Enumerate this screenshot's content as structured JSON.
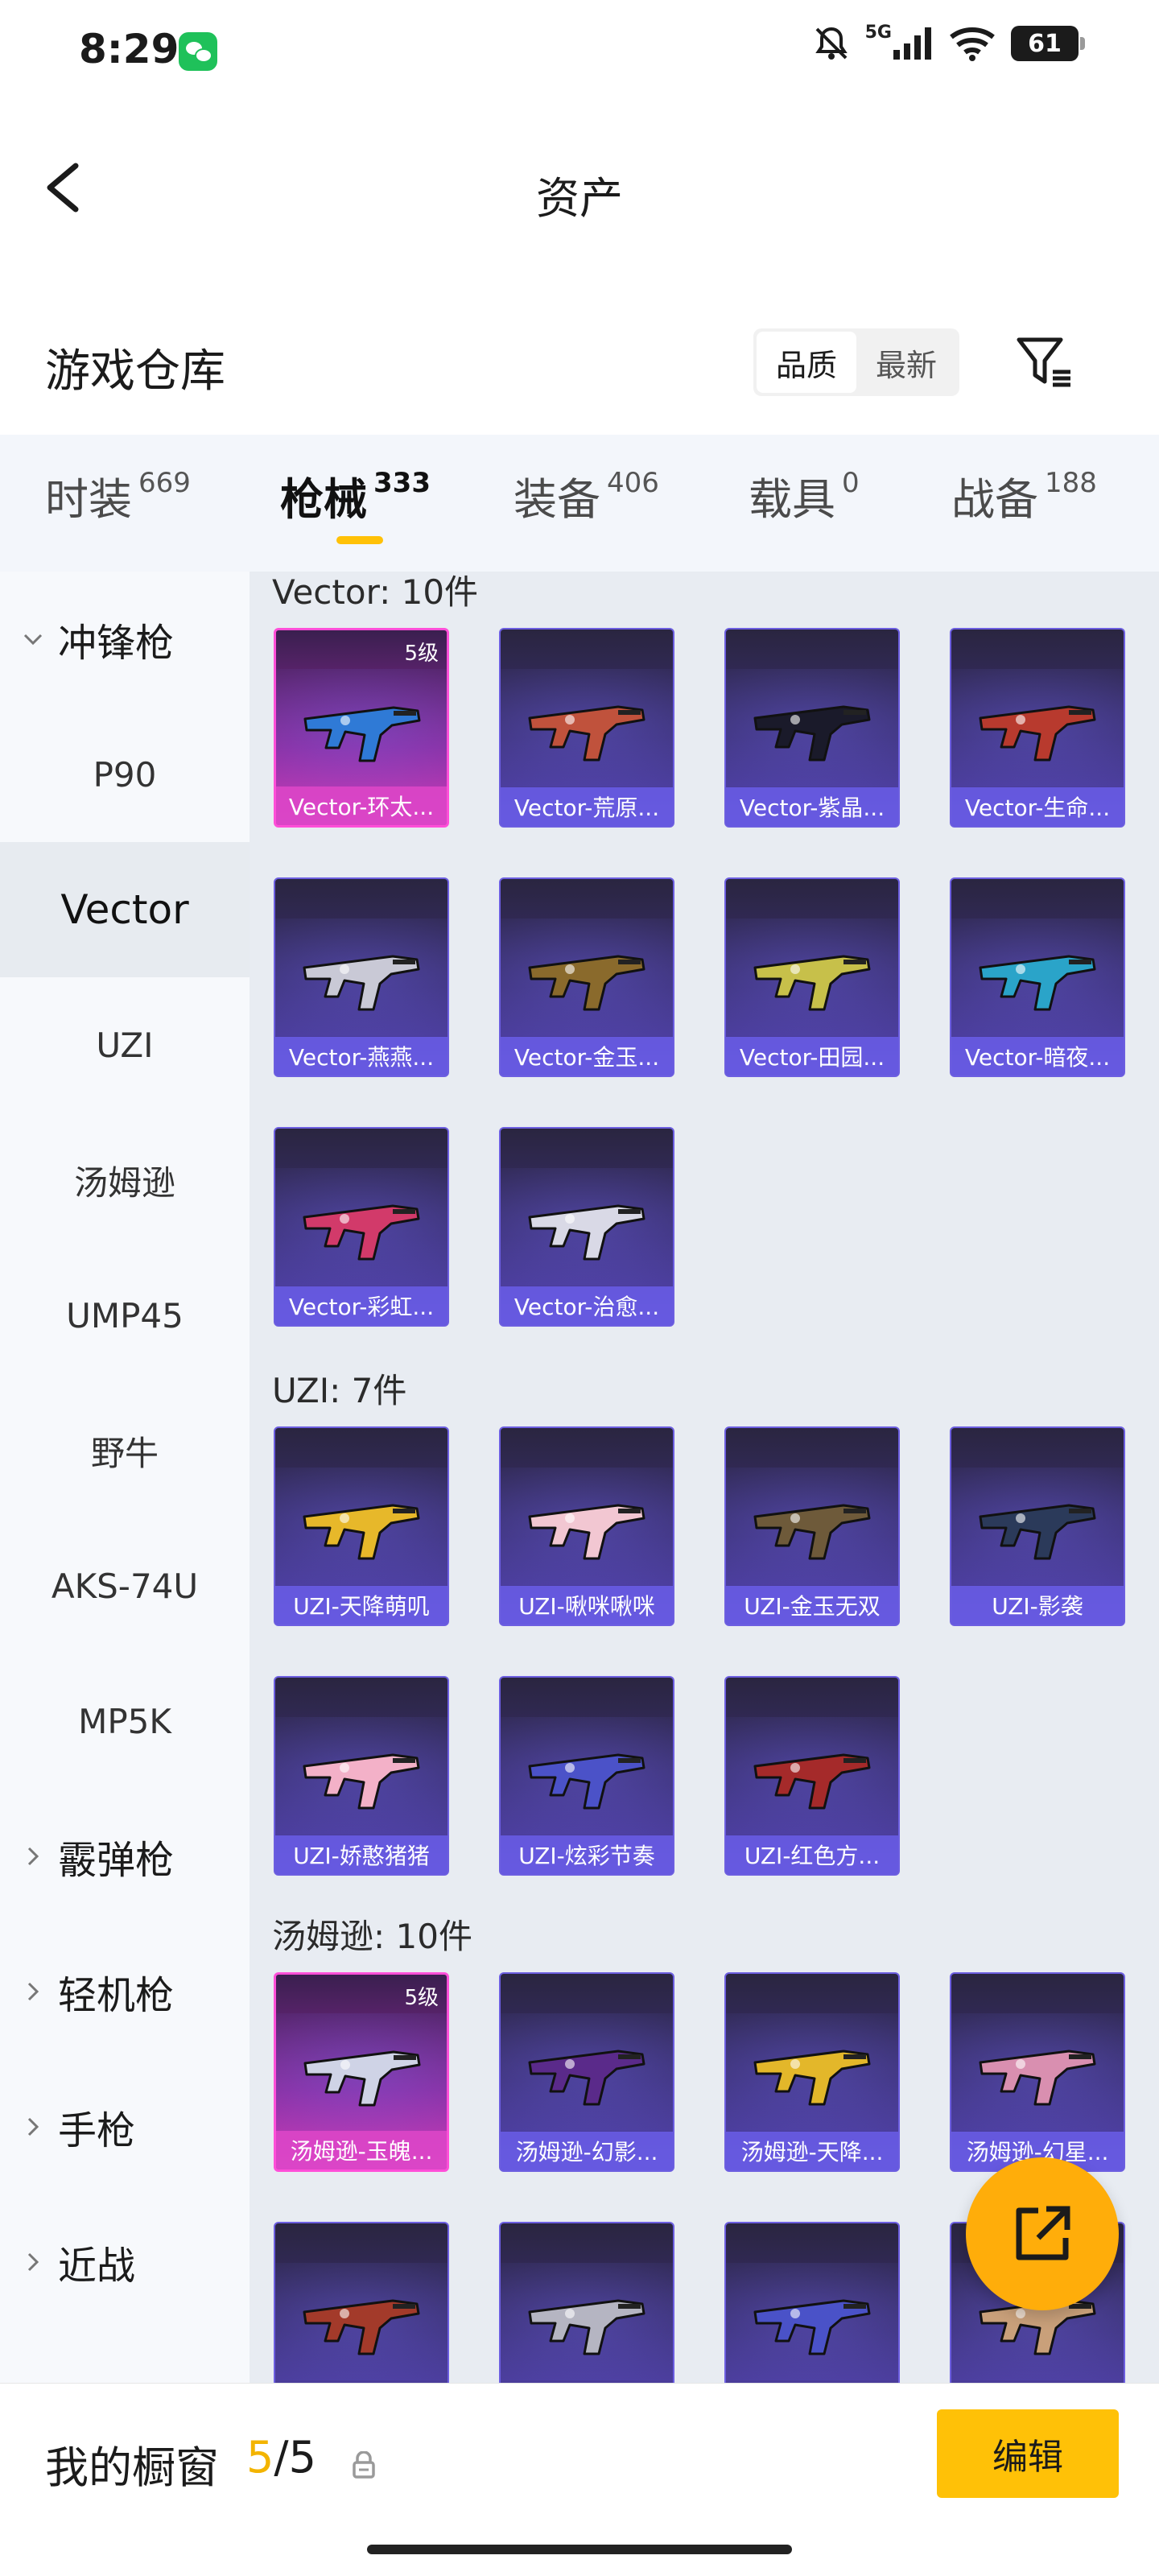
{
  "status_bar": {
    "time": "8:29",
    "network": "5G",
    "battery": "61"
  },
  "header": {
    "title": "资产"
  },
  "section": {
    "title": "游戏仓库",
    "sort_options": [
      "品质",
      "最新"
    ],
    "active_sort": "品质"
  },
  "tabs": [
    {
      "label": "时装",
      "count": "669"
    },
    {
      "label": "枪械",
      "count": "333"
    },
    {
      "label": "装备",
      "count": "406"
    },
    {
      "label": "载具",
      "count": "0"
    },
    {
      "label": "战备",
      "count": "188"
    }
  ],
  "sidebar": {
    "items": [
      {
        "label": "冲锋枪",
        "kind": "group",
        "expanded": true
      },
      {
        "label": "P90"
      },
      {
        "label": "Vector",
        "active": true
      },
      {
        "label": "UZI"
      },
      {
        "label": "汤姆逊"
      },
      {
        "label": "UMP45"
      },
      {
        "label": "野牛"
      },
      {
        "label": "AKS-74U"
      },
      {
        "label": "MP5K"
      },
      {
        "label": "霰弹枪",
        "kind": "group"
      },
      {
        "label": "轻机枪",
        "kind": "group"
      },
      {
        "label": "手枪",
        "kind": "group"
      },
      {
        "label": "近战",
        "kind": "group"
      }
    ]
  },
  "groups": [
    {
      "title": "Vector: 10件",
      "items": [
        {
          "name": "Vector-环太...",
          "level": "5级",
          "rarity": "epic",
          "color": "#2f7ad6"
        },
        {
          "name": "Vector-荒原...",
          "color": "#c0523c"
        },
        {
          "name": "Vector-紫晶...",
          "color": "#1a1a2a"
        },
        {
          "name": "Vector-生命...",
          "color": "#b83a2e"
        },
        {
          "name": "Vector-燕燕...",
          "color": "#c9c9d6"
        },
        {
          "name": "Vector-金玉...",
          "color": "#8a6a2c"
        },
        {
          "name": "Vector-田园...",
          "color": "#c7c04a"
        },
        {
          "name": "Vector-暗夜...",
          "color": "#2aa4c9"
        },
        {
          "name": "Vector-彩虹...",
          "color": "#d23a6a"
        },
        {
          "name": "Vector-治愈...",
          "color": "#d9d9e6"
        }
      ]
    },
    {
      "title": "UZI: 7件",
      "items": [
        {
          "name": "UZI-天降萌叽",
          "color": "#e7b82a"
        },
        {
          "name": "UZI-啾咪啾咪",
          "color": "#f2c7d2"
        },
        {
          "name": "UZI-金玉无双",
          "color": "#6e5a3a"
        },
        {
          "name": "UZI-影袭",
          "color": "#2b3a5a"
        },
        {
          "name": "UZI-娇憨猪猪",
          "color": "#f3b1c8"
        },
        {
          "name": "UZI-炫彩节奏",
          "color": "#4b52c8"
        },
        {
          "name": "UZI-红色方...",
          "color": "#a52a2a"
        }
      ]
    },
    {
      "title": "汤姆逊: 10件",
      "items": [
        {
          "name": "汤姆逊-玉魄...",
          "level": "5级",
          "rarity": "epic",
          "color": "#cfd3e6"
        },
        {
          "name": "汤姆逊-幻影...",
          "color": "#5a2a8a"
        },
        {
          "name": "汤姆逊-天降...",
          "color": "#e3b72a"
        },
        {
          "name": "汤姆逊-幻星...",
          "color": "#d98fb0"
        },
        {
          "name": "",
          "color": "#a33a2a"
        },
        {
          "name": "",
          "color": "#b5b5c2"
        },
        {
          "name": "",
          "color": "#4a52c8"
        },
        {
          "name": "",
          "color": "#c9a07a"
        }
      ]
    }
  ],
  "bottom_bar": {
    "label": "我的橱窗",
    "count_current": "5",
    "count_sep": "/",
    "count_total": "5",
    "edit_label": "编辑"
  },
  "colors": {
    "accent": "#ffc107",
    "fab": "#ffad0a",
    "epic": "#ff4fd8",
    "normal_card_border": "#6c5ee0"
  }
}
